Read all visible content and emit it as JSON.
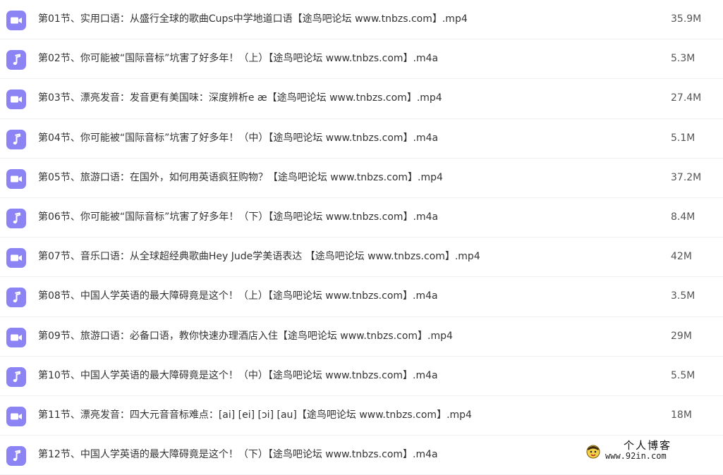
{
  "files": [
    {
      "name": "第01节、实用口语：从盛行全球的歌曲Cups中学地道口语【途鸟吧论坛 www.tnbzs.com】.mp4",
      "size": "35.9M",
      "icon": "video-icon"
    },
    {
      "name": "第02节、你可能被“国际音标”坑害了好多年！（上）【途鸟吧论坛 www.tnbzs.com】.m4a",
      "size": "5.3M",
      "icon": "audio-icon"
    },
    {
      "name": "第03节、漂亮发音：发音更有美国味：深度辨析e æ【途鸟吧论坛 www.tnbzs.com】.mp4",
      "size": "27.4M",
      "icon": "video-icon"
    },
    {
      "name": "第04节、你可能被“国际音标”坑害了好多年！（中）【途鸟吧论坛 www.tnbzs.com】.m4a",
      "size": "5.1M",
      "icon": "audio-icon"
    },
    {
      "name": "第05节、旅游口语：在国外，如何用英语疯狂购物？【途鸟吧论坛 www.tnbzs.com】.mp4",
      "size": "37.2M",
      "icon": "video-icon"
    },
    {
      "name": "第06节、你可能被“国际音标”坑害了好多年！（下）【途鸟吧论坛 www.tnbzs.com】.m4a",
      "size": "8.4M",
      "icon": "audio-icon"
    },
    {
      "name": "第07节、音乐口语：从全球超经典歌曲Hey Jude学美语表达 【途鸟吧论坛 www.tnbzs.com】.mp4",
      "size": "42M",
      "icon": "video-icon"
    },
    {
      "name": "第08节、中国人学英语的最大障碍竟是这个！（上）【途鸟吧论坛 www.tnbzs.com】.m4a",
      "size": "3.5M",
      "icon": "audio-icon"
    },
    {
      "name": "第09节、旅游口语：必备口语，教你快速办理酒店入住【途鸟吧论坛 www.tnbzs.com】.mp4",
      "size": "29M",
      "icon": "video-icon"
    },
    {
      "name": "第10节、中国人学英语的最大障碍竟是这个！（中）【途鸟吧论坛 www.tnbzs.com】.m4a",
      "size": "5.5M",
      "icon": "audio-icon"
    },
    {
      "name": "第11节、漂亮发音：四大元音音标难点：[ai] [ei] [ɔi] [au]【途鸟吧论坛 www.tnbzs.com】.mp4",
      "size": "18M",
      "icon": "video-icon"
    },
    {
      "name": "第12节、中国人学英语的最大障碍竟是这个！（下）【途鸟吧论坛 www.tnbzs.com】.m4a",
      "size": "",
      "icon": "audio-icon"
    }
  ],
  "watermark": {
    "title": "个人博客",
    "url": "www.92in.com"
  },
  "colors": {
    "icon_background": "#8c83f5",
    "icon_glyph": "#ffffff",
    "row_divider": "#f0f0f3"
  }
}
